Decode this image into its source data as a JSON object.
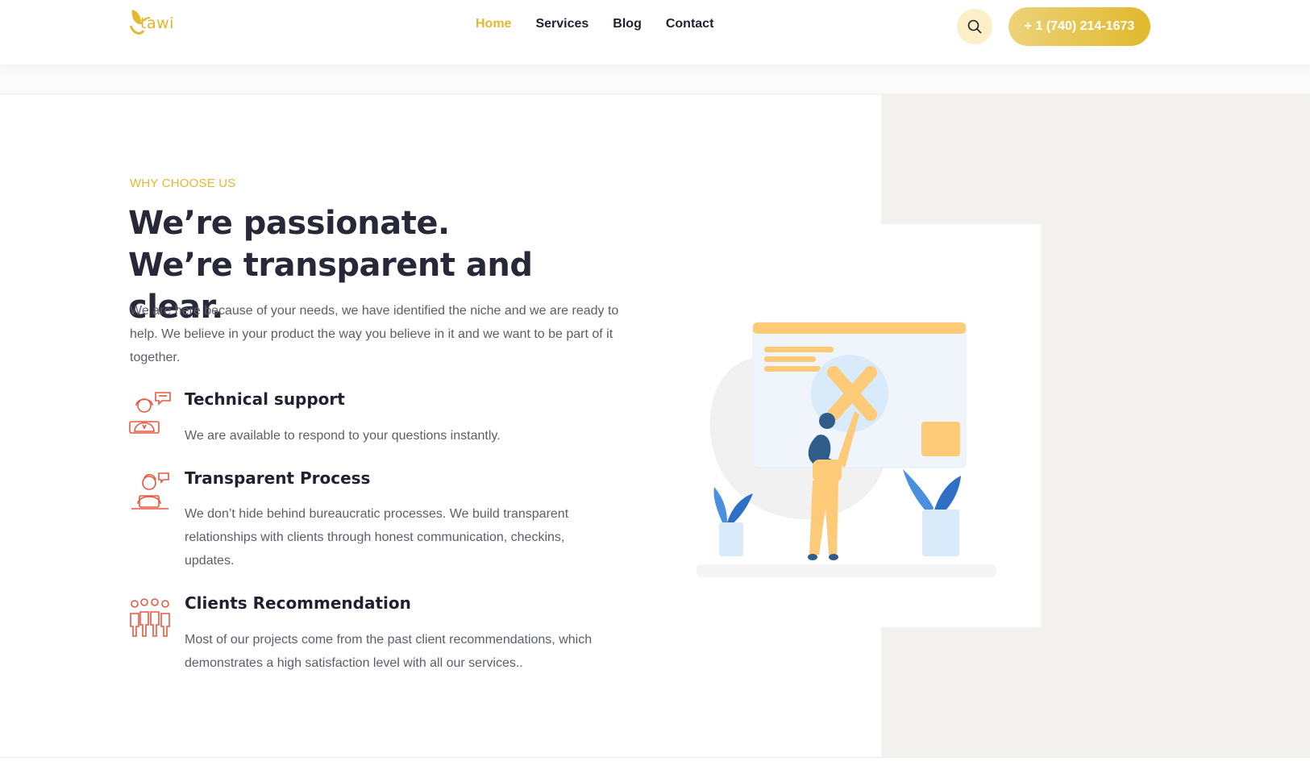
{
  "header": {
    "logo_text": "tawi",
    "nav": [
      {
        "label": "Home",
        "active": true
      },
      {
        "label": "Services",
        "active": false
      },
      {
        "label": "Blog",
        "active": false
      },
      {
        "label": "Contact",
        "active": false
      }
    ],
    "search_icon": "search-icon",
    "phone_label": "+ 1 (740) 214-1673"
  },
  "colors": {
    "accent": "#e1b931",
    "heading": "#272838",
    "body_text": "#5b5d6b",
    "icon_red": "#e8573f",
    "panel_bg": "#f3f2ef"
  },
  "section": {
    "eyebrow": "WHY CHOOSE US",
    "headline": "We’re passionate. We’re transparent and clear.",
    "lead": "We are here because of your needs, we have identified the niche and we are ready to help. We believe in your product the way you believe in it and we want to be part of it together.",
    "features": [
      {
        "icon": "support-agent-icon",
        "title": "Technical support",
        "text": "We are available to respond to your questions instantly."
      },
      {
        "icon": "laptop-user-icon",
        "title": "Transparent Process",
        "text": "We don’t hide behind bureaucratic processes. We build transparent relationships with clients through honest communication, checkins, updates."
      },
      {
        "icon": "team-people-icon",
        "title": "Clients Recommendation",
        "text": "Most of our projects come from the past client recommendations, which demonstrates a high satisfaction level with all our services.."
      }
    ],
    "illustration": "woman-removing-x-illustration"
  }
}
